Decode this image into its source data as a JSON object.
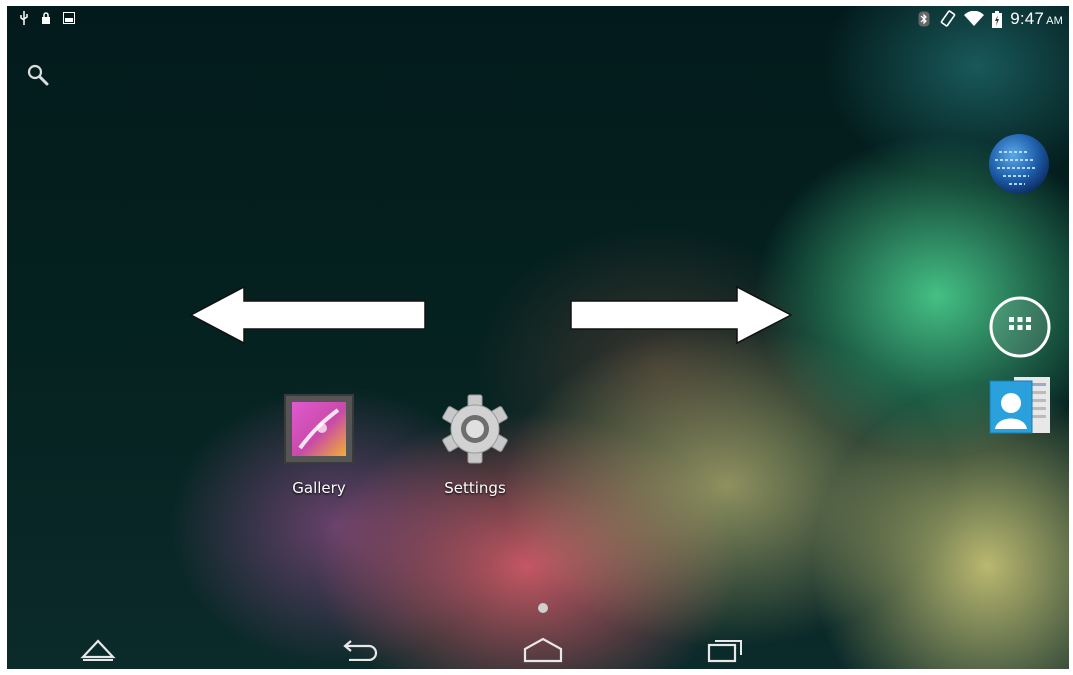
{
  "status_bar": {
    "left_icons": [
      "usb-icon",
      "lock-icon",
      "image-icon"
    ],
    "right_icons": [
      "bluetooth-icon",
      "rotate-icon",
      "wifi-icon",
      "battery-icon"
    ],
    "time": "9:47",
    "ampm": "AM"
  },
  "search_icon": "search-icon",
  "swipe_arrows": [
    "left-arrow-icon",
    "right-arrow-icon"
  ],
  "home_apps": [
    {
      "label": "Gallery",
      "icon": "gallery-icon"
    },
    {
      "label": "Settings",
      "icon": "settings-gear-icon"
    }
  ],
  "dock": [
    {
      "icon": "browser-globe-icon"
    },
    {
      "icon": "all-apps-icon"
    },
    {
      "icon": "contacts-icon"
    }
  ],
  "nav_bar": [
    "up-icon",
    "back-icon",
    "home-icon",
    "recent-apps-icon"
  ],
  "colors": {
    "accent_green": "#5fe0a0",
    "icon_white": "#ffffff"
  }
}
